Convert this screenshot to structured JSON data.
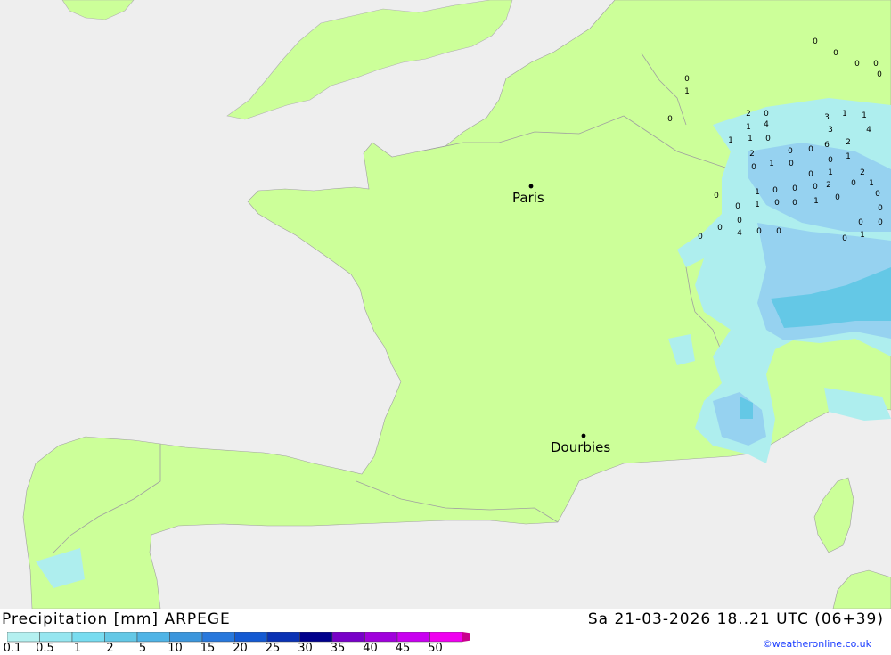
{
  "map": {
    "cities": [
      {
        "name": "Paris"
      },
      {
        "name": "Dourbies"
      }
    ],
    "values": [
      "0",
      "0",
      "0",
      "0",
      "0",
      "0",
      "1",
      "0",
      "2",
      "0",
      "1",
      "1",
      "1",
      "4",
      "3",
      "1",
      "0",
      "1",
      "2",
      "3",
      "4",
      "6",
      "2",
      "0",
      "0",
      "0",
      "1",
      "0",
      "1",
      "0",
      "0",
      "1",
      "2",
      "2",
      "0",
      "1",
      "0",
      "0",
      "0",
      "0",
      "1",
      "0",
      "0",
      "0",
      "1",
      "0",
      "0",
      "1",
      "0",
      "0",
      "0",
      "0",
      "0",
      "0",
      "4",
      "0",
      "0",
      "0",
      "1",
      "1"
    ],
    "colors": {
      "sea": "#eeeeee",
      "land": "#ccff99",
      "border": "#a0a0a0",
      "precip_light": "#aeeeee",
      "precip_mid": "#96d2f0",
      "precip_heavy": "#64c8e6"
    }
  },
  "footer": {
    "title": "Precipitation [mm] ARPEGE",
    "datetime": "Sa 21-03-2026 18..21 UTC (06+39)",
    "credit": "©weatheronline.co.uk",
    "legend": {
      "ticks": [
        "0.1",
        "0.5",
        "1",
        "2",
        "5",
        "10",
        "15",
        "20",
        "25",
        "30",
        "35",
        "40",
        "45",
        "50"
      ],
      "colors": [
        "#b4f0f0",
        "#96e6f0",
        "#78dcf0",
        "#64c8e6",
        "#50b4e6",
        "#3c96dc",
        "#2878dc",
        "#145ad2",
        "#0a32b4",
        "#00008c",
        "#7800c8",
        "#a000dc",
        "#c800f0",
        "#f000f0",
        "#c8008c"
      ]
    }
  }
}
